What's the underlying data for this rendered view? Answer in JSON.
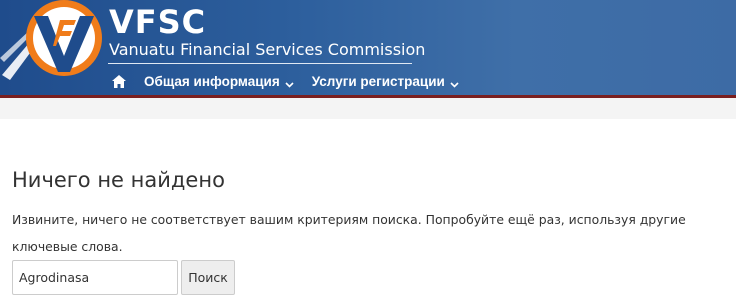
{
  "header": {
    "brand_title": "VFSC",
    "brand_subtitle": "Vanuatu Financial Services Commission",
    "logo_icon": "vfsc-logo-icon",
    "colors": {
      "gradient_start": "#1f4c8c",
      "gradient_end": "#3d6ba5",
      "accent_line": "#7a1f1f",
      "logo_orange": "#f07c1a"
    }
  },
  "nav": {
    "home_icon": "home-icon",
    "items": [
      {
        "label": "Общая информация",
        "icon": "chevron-down-icon"
      },
      {
        "label": "Услуги регистрации",
        "icon": "chevron-down-icon"
      }
    ]
  },
  "main": {
    "title": "Ничего не найдено",
    "message": "Извините, ничего не соответствует вашим критериям поиска. Попробуйте ещё раз, используя другие ключевые слова."
  },
  "search": {
    "value": "Agrodinasa",
    "button_label": "Поиск"
  }
}
